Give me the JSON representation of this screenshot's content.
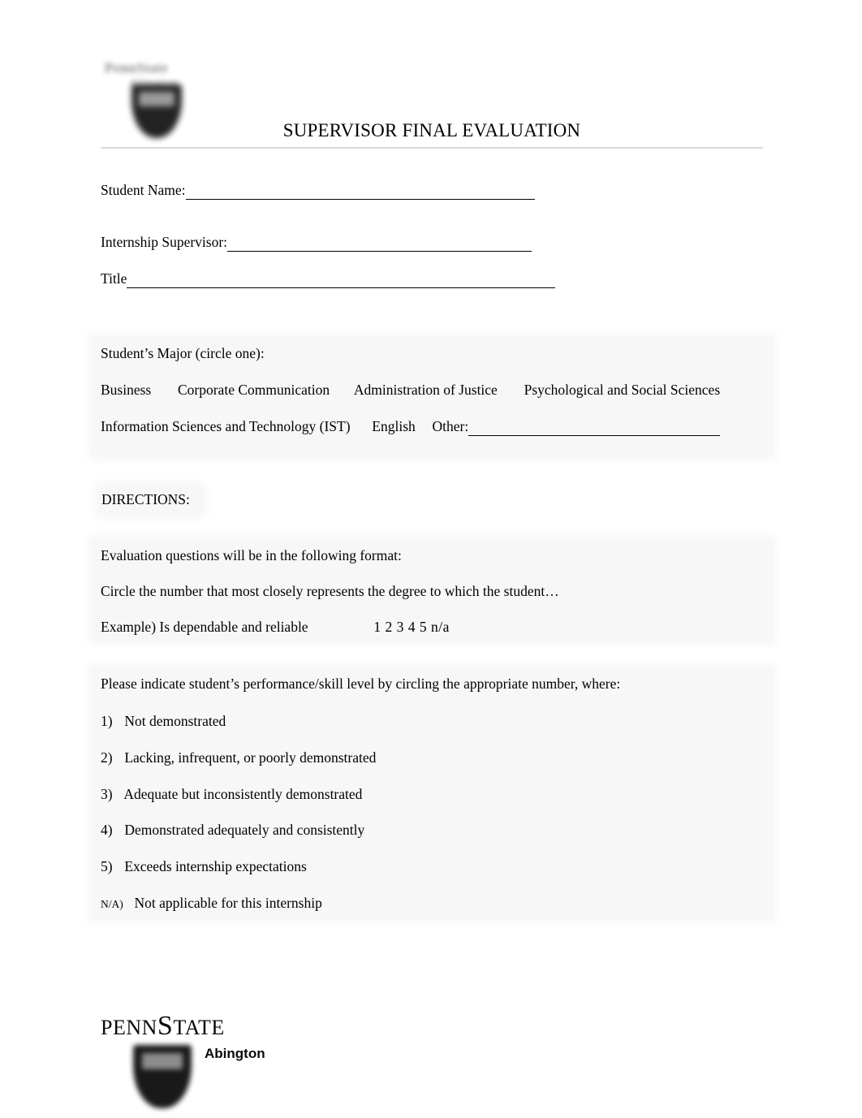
{
  "header": {
    "logo_line1": "PennState",
    "logo_line2": "Abington",
    "title": "SUPERVISOR FINAL EVALUATION"
  },
  "fields": [
    {
      "label": "Student Name:"
    },
    {
      "label": "Internship Supervisor:"
    },
    {
      "label": "Title"
    }
  ],
  "major_block": {
    "heading": "Student’s Major (circle one):",
    "row1": [
      "Business",
      "Corporate Communication",
      "Administration of Justice",
      "Psychological and Social Sciences"
    ],
    "row2_a": "Information Sciences and Technology (IST)",
    "row2_b": "English",
    "row2_other": "Other:"
  },
  "directions_label": "DIRECTIONS:",
  "format_block": {
    "line1": "Evaluation questions will be in the following format:",
    "line2": "Circle the number that most closely represents the degree to which the student…",
    "example_label": "Example)  Is dependable and reliable",
    "example_scale": "1  2  3  4  5   n/a"
  },
  "scale_block": {
    "intro": "Please indicate student’s performance/skill level by circling the appropriate number, where:",
    "items": [
      {
        "num": "1)",
        "text": "Not demonstrated"
      },
      {
        "num": "2)",
        "text": "Lacking, infrequent, or poorly demonstrated"
      },
      {
        "num": "3)",
        "text": "Adequate but inconsistently demonstrated"
      },
      {
        "num": "4)",
        "text": "Demonstrated adequately and consistently"
      },
      {
        "num": "5)",
        "text": "Exceeds internship expectations"
      },
      {
        "num": "N/A)",
        "text": "Not applicable for this internship"
      }
    ]
  },
  "footer": {
    "penn": "PENN",
    "s": "S",
    "tate": "TATE",
    "campus": "Abington"
  }
}
